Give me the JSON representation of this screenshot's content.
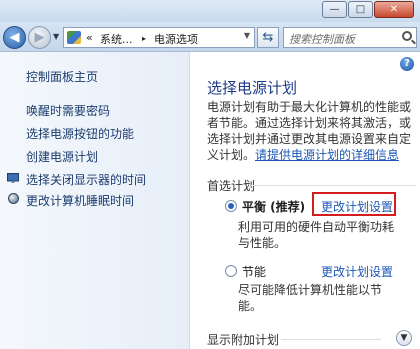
{
  "window": {
    "minimize_glyph": "—",
    "maximize_glyph": "□",
    "close_glyph": "✕"
  },
  "address": {
    "prefix": "«",
    "crumb1": "系统...",
    "separator": "▸",
    "crumb2": "电源选项"
  },
  "search": {
    "placeholder": "搜索控制面板"
  },
  "sidebar": {
    "home": "控制面板主页",
    "items": [
      {
        "label": "唤醒时需要密码"
      },
      {
        "label": "选择电源按钮的功能"
      },
      {
        "label": "创建电源计划"
      },
      {
        "label": "选择关闭显示器的时间"
      },
      {
        "label": "更改计算机睡眠时间"
      }
    ]
  },
  "main": {
    "help": "?",
    "title": "选择电源计划",
    "desc_lines": [
      "电源计划有助于最大化计算机的性能或",
      "者节能。通过选择计划来将其激活，或",
      "选择计划并通过更改其电源设置来自定",
      "义计划。"
    ],
    "desc_link": "请提供电源计划的详细信息",
    "section_label": "首选计划",
    "plans": [
      {
        "name": "平衡 (推荐)",
        "change_link": "更改计划设置",
        "desc_lines": [
          "利用可用的硬件自动平衡功耗",
          "与性能。"
        ],
        "selected": true
      },
      {
        "name": "节能",
        "change_link": "更改计划设置",
        "desc_lines": [
          "尽可能降低计算机性能以节",
          "能。"
        ],
        "selected": false
      }
    ],
    "show_more": "显示附加计划"
  }
}
